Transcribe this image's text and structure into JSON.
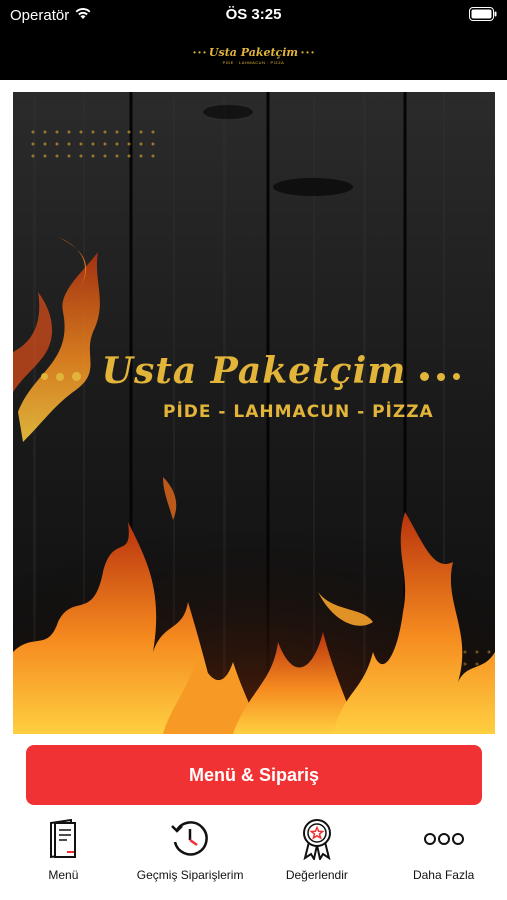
{
  "status_bar": {
    "carrier": "Operatör",
    "time": "ÖS 3:25"
  },
  "header": {
    "logo_text": "Usta Paketçim",
    "logo_subtext": "PİDE · LAHMACUN · PİZZA"
  },
  "hero": {
    "brand_name": "Usta Paketçim",
    "tagline": "PİDE - LAHMACUN - PİZZA"
  },
  "cta": {
    "label": "Menü & Sipariş"
  },
  "tabbar": {
    "items": [
      {
        "label": "Menü",
        "icon": "menu-book-icon"
      },
      {
        "label": "Geçmiş Siparişlerim",
        "icon": "history-icon"
      },
      {
        "label": "Değerlendir",
        "icon": "award-badge-icon"
      },
      {
        "label": "Daha Fazla",
        "icon": "more-dots-icon"
      }
    ]
  },
  "colors": {
    "accent": "#f13234",
    "gold": "#e2b53a",
    "status_bar_bg": "#000000"
  }
}
